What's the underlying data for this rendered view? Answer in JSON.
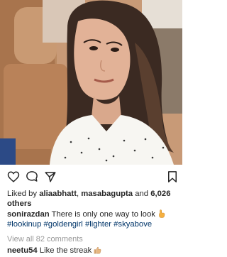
{
  "post": {
    "photo_icon": "portrait-photo",
    "actions": {
      "like_icon": "heart-icon",
      "comment_icon": "comment-bubble-icon",
      "share_icon": "send-arrow-icon",
      "save_icon": "bookmark-icon"
    },
    "likes": {
      "prefix": "Liked by ",
      "user_1": "aliaabhatt",
      "separator": ", ",
      "user_2": "masabagupta",
      "and": " and ",
      "count": "6,026",
      "others": "others"
    },
    "caption": {
      "username": "sonirazdan",
      "text": " There is only one way to look ",
      "emoji": "pointing-up-hand-icon",
      "hashtags": [
        "#lookinup",
        "#goldengirl",
        "#lighter",
        "#skyabove"
      ]
    },
    "view_all_comments": "View all 82 comments",
    "comments": [
      {
        "username": "neetu54",
        "text": " Like the streak ",
        "emoji": "thumbs-up-icon"
      }
    ]
  },
  "colors": {
    "text": "#262626",
    "hashtag": "#003569",
    "muted": "#999999",
    "emoji": "#f5b041"
  }
}
